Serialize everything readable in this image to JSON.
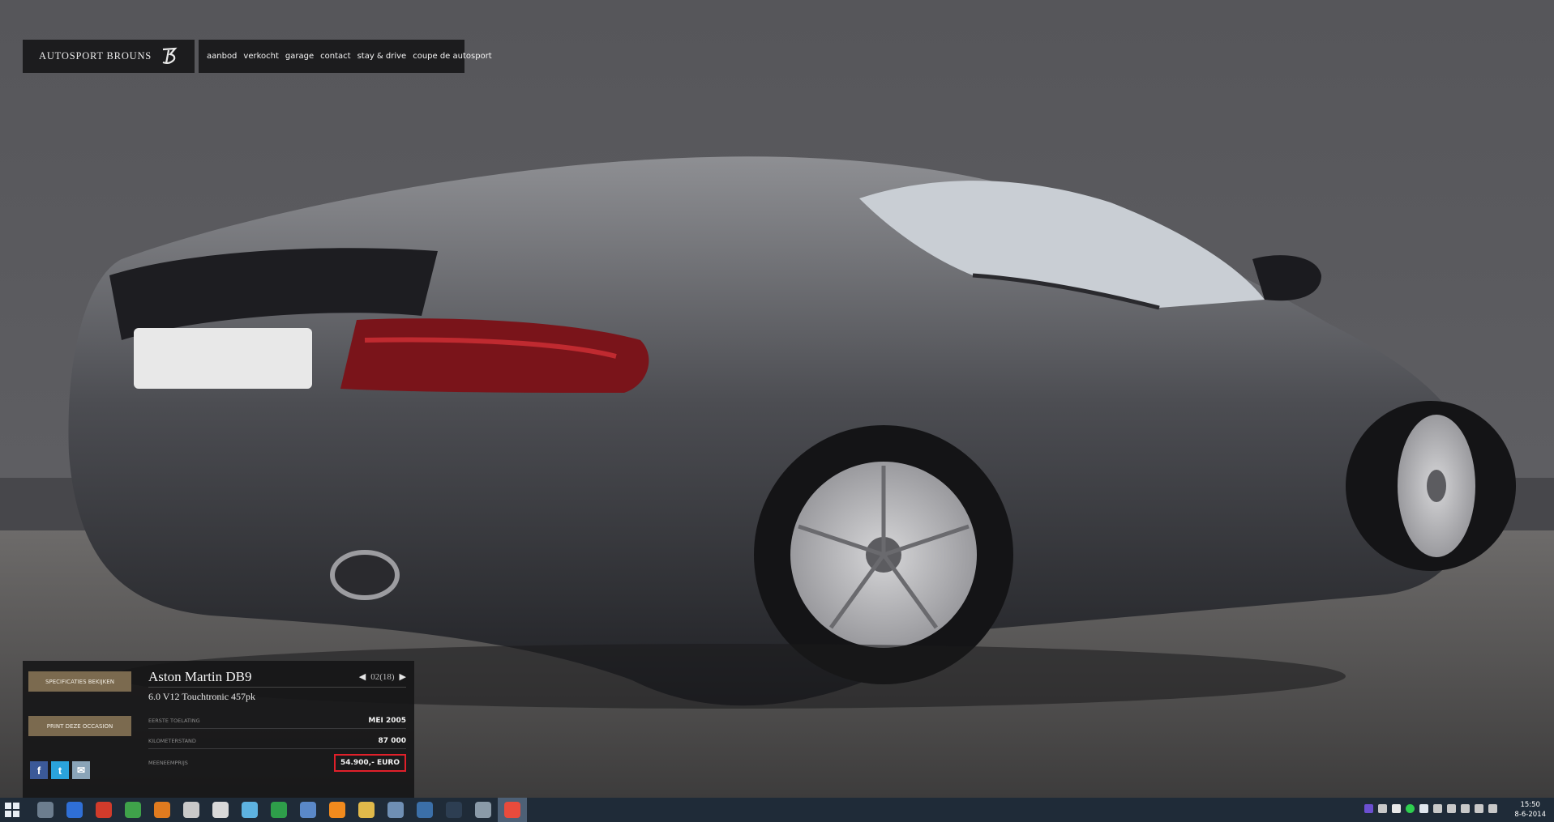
{
  "header": {
    "logo_text": "AUTOSPORT BROUNS",
    "nav": [
      "aanbod",
      "verkocht",
      "garage",
      "contact",
      "stay & drive",
      "coupe de autosport"
    ]
  },
  "car": {
    "title": "Aston Martin DB9",
    "subtitle": "6.0 V12 Touchtronic 457pk",
    "pager": "02(18)",
    "specs_button": "SPECIFICATIES BEKIJKEN",
    "print_button": "PRINT DEZE OCCASION",
    "rows": [
      {
        "label": "EERSTE TOELATING",
        "value": "MEI 2005"
      },
      {
        "label": "KILOMETERSTAND",
        "value": "87 000"
      },
      {
        "label": "MEENEEMPRIJS",
        "value": "54.900,- EURO"
      }
    ],
    "social": {
      "facebook": "f",
      "twitter": "t",
      "mail": "✉"
    }
  },
  "taskbar": {
    "time": "15:50",
    "date": "8-6-2014",
    "icons": [
      {
        "name": "file-explorer-icon",
        "color": "#6c7d8e"
      },
      {
        "name": "malwarebytes-icon",
        "color": "#2f6fd6"
      },
      {
        "name": "ccleaner-icon",
        "color": "#d13b2b"
      },
      {
        "name": "utility-icon",
        "color": "#3fa24a"
      },
      {
        "name": "media-player-icon",
        "color": "#e07b1f"
      },
      {
        "name": "app-icon",
        "color": "#c9c9c9"
      },
      {
        "name": "paint-icon",
        "color": "#d9d9d9"
      },
      {
        "name": "document-app-icon",
        "color": "#5db2e0"
      },
      {
        "name": "utorrent-icon",
        "color": "#2e9e4a"
      },
      {
        "name": "notepad-icon",
        "color": "#5a88c8"
      },
      {
        "name": "vlc-icon",
        "color": "#f18a1d"
      },
      {
        "name": "folder-icon",
        "color": "#e0b94a"
      },
      {
        "name": "game-app-icon",
        "color": "#6f8fb4"
      },
      {
        "name": "avatar-app-icon",
        "color": "#3b6fa8"
      },
      {
        "name": "steam-icon",
        "color": "#2d3e52"
      },
      {
        "name": "camera-app-icon",
        "color": "#8a9aa8"
      },
      {
        "name": "chrome-icon",
        "color": "#e94b3c"
      }
    ]
  }
}
